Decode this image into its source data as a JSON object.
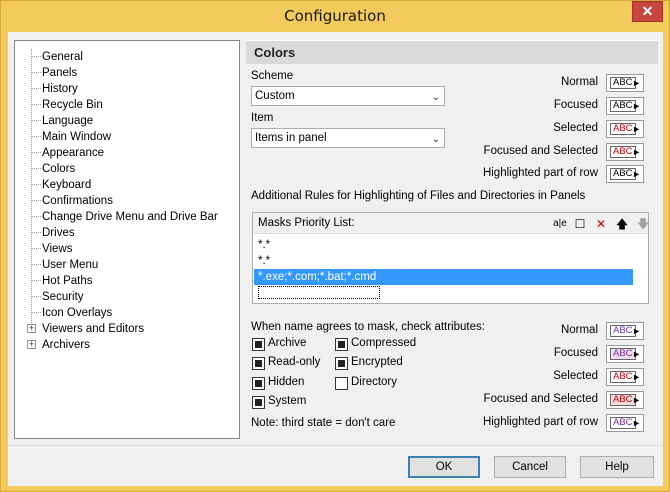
{
  "window": {
    "title": "Configuration",
    "close_glyph": "✕"
  },
  "tree": {
    "items": [
      {
        "label": "General"
      },
      {
        "label": "Panels"
      },
      {
        "label": "History"
      },
      {
        "label": "Recycle Bin"
      },
      {
        "label": "Language"
      },
      {
        "label": "Main Window"
      },
      {
        "label": "Appearance"
      },
      {
        "label": "Colors"
      },
      {
        "label": "Keyboard"
      },
      {
        "label": "Confirmations"
      },
      {
        "label": "Change Drive Menu and Drive Bar"
      },
      {
        "label": "Drives"
      },
      {
        "label": "Views"
      },
      {
        "label": "User Menu"
      },
      {
        "label": "Hot Paths"
      },
      {
        "label": "Security"
      },
      {
        "label": "Icon Overlays"
      },
      {
        "label": "Viewers and Editors",
        "expandable": true
      },
      {
        "label": "Archivers",
        "expandable": true
      }
    ],
    "expander_glyph": "+"
  },
  "panel": {
    "title": "Colors",
    "scheme": {
      "label": "Scheme",
      "value": "Custom"
    },
    "item": {
      "label": "Item",
      "value": "Items in panel"
    },
    "dropdown_glyph": "⌄",
    "top_colors": [
      {
        "label": "Normal",
        "swatch": "ABC",
        "fg": "#000000",
        "bg": "#ffffff"
      },
      {
        "label": "Focused",
        "swatch": "ABC",
        "fg": "#000000",
        "bg": "#ffffff"
      },
      {
        "label": "Selected",
        "swatch": "ABC",
        "fg": "#c00000",
        "bg": "#ffffff"
      },
      {
        "label": "Focused and Selected",
        "swatch": "ABC",
        "fg": "#c00000",
        "bg": "#ffffff"
      },
      {
        "label": "Highlighted part of row",
        "swatch": "ABC",
        "fg": "#000000",
        "bg": "#ffffff"
      }
    ],
    "arrow_glyph": "►",
    "rules_heading": "Additional Rules for Highlighting of Files and Directories in Panels",
    "masks": {
      "header": "Masks Priority List:",
      "rows": [
        "*.*",
        "*.*",
        "*.exe;*.com;*.bat;*.cmd",
        ""
      ],
      "selected_index": 2,
      "tools": [
        {
          "name": "rename-icon",
          "glyph": "a|e"
        },
        {
          "name": "new-icon",
          "glyph": "☐"
        },
        {
          "name": "delete-icon",
          "glyph": "✕",
          "color": "#c00000"
        },
        {
          "name": "move-up-icon",
          "glyph": "🡅"
        },
        {
          "name": "move-down-icon",
          "glyph": "🡇",
          "color": "#a0a0a0"
        }
      ]
    },
    "attributes": {
      "heading": "When name agrees to mask, check attributes:",
      "left": [
        {
          "label": "Archive",
          "checked": true
        },
        {
          "label": "Read-only",
          "checked": true
        },
        {
          "label": "Hidden",
          "checked": true
        },
        {
          "label": "System",
          "checked": true
        }
      ],
      "right": [
        {
          "label": "Compressed",
          "checked": true
        },
        {
          "label": "Encrypted",
          "checked": true
        },
        {
          "label": "Directory",
          "checked": false
        }
      ],
      "note": "Note: third state = don't care"
    },
    "bottom_colors": [
      {
        "label": "Normal",
        "swatch": "ABC",
        "fg": "#7030a0",
        "bg": "#ffffff"
      },
      {
        "label": "Focused",
        "swatch": "ABC",
        "fg": "#7030a0",
        "bg": "#f2dcf6"
      },
      {
        "label": "Selected",
        "swatch": "ABC",
        "fg": "#c00000",
        "bg": "#ffffff"
      },
      {
        "label": "Focused and Selected",
        "swatch": "ABC",
        "fg": "#c00000",
        "bg": "#f6dcdc"
      },
      {
        "label": "Highlighted part of row",
        "swatch": "ABC",
        "fg": "#7030a0",
        "bg": "#ffffff"
      }
    ]
  },
  "buttons": {
    "ok": "OK",
    "cancel": "Cancel",
    "help": "Help"
  },
  "colors": {
    "title_bar": "#f3ca5c",
    "selection": "#3399ff"
  }
}
